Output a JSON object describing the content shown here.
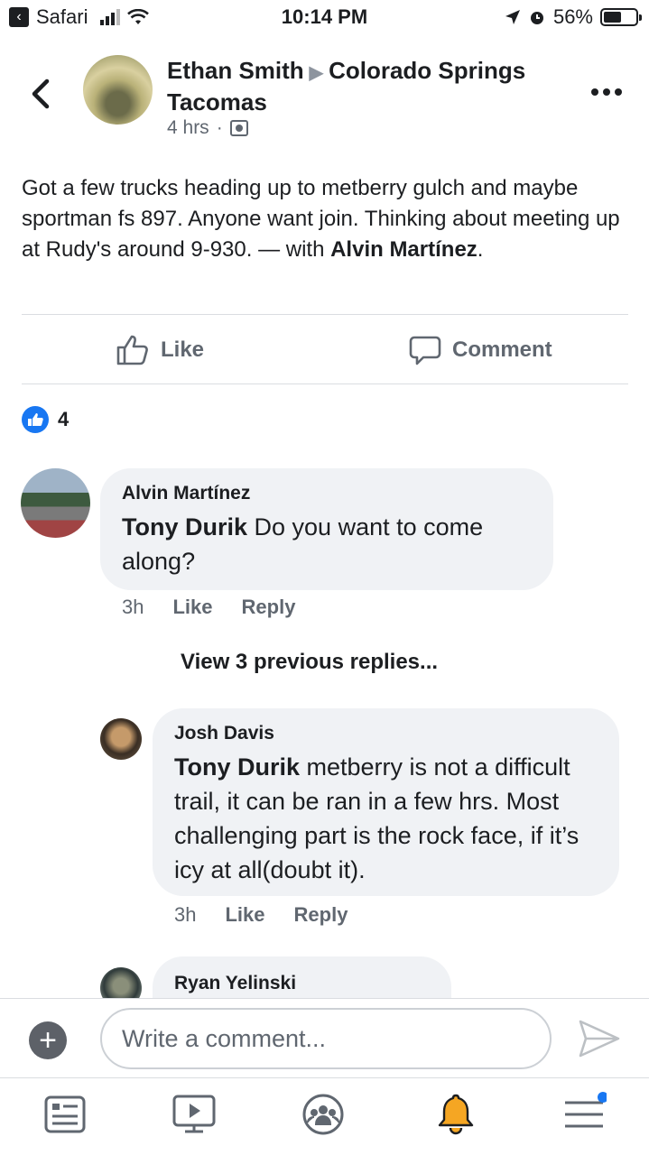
{
  "status": {
    "back_app": "Safari",
    "time": "10:14 PM",
    "battery": "56%",
    "battery_level": 0.56
  },
  "header": {
    "author": "Ethan Smith",
    "group": "Colorado Springs Tacomas",
    "time_ago": "4 hrs",
    "separator": "·"
  },
  "post": {
    "text": "Got a few trucks heading up to metberry gulch and maybe sportman fs 897. Anyone want join. Thinking about meeting up at Rudy's around 9-930. — with ",
    "tagged": "Alvin Martínez",
    "end": "."
  },
  "actions": {
    "like": "Like",
    "comment": "Comment"
  },
  "reactions": {
    "count": "4"
  },
  "comments": [
    {
      "name": "Alvin Martínez",
      "mention": "Tony Durik",
      "text": " Do you want to come along?",
      "time": "3h",
      "like": "Like",
      "reply": "Reply"
    }
  ],
  "view_prev": "View 3 previous replies...",
  "replies": [
    {
      "name": "Josh Davis",
      "mention": "Tony Durik",
      "text": "  metberry is not a difficult trail, it can be ran in a few hrs.  Most challenging part is the rock face, if it’s icy at all(doubt it).",
      "time": "3h",
      "like": "Like",
      "reply": "Reply"
    },
    {
      "name": "Ryan Yelinski"
    }
  ],
  "composer": {
    "placeholder": "Write a comment..."
  },
  "colors": {
    "accent": "#1877f2",
    "bubble": "#f0f2f5",
    "muted": "#606770",
    "bell": "#f5a623"
  },
  "icons": [
    "back-arrow-icon",
    "more-icon",
    "like-icon",
    "comment-icon",
    "plus-icon",
    "send-icon",
    "news-feed-icon",
    "watch-icon",
    "groups-icon",
    "notifications-bell-icon",
    "menu-icon"
  ]
}
